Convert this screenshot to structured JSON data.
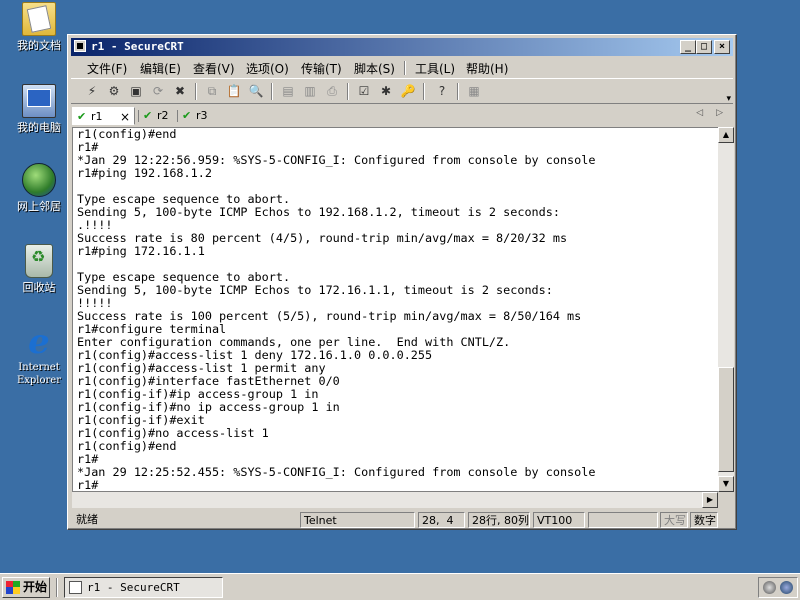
{
  "desktop": {
    "icons": [
      {
        "label": "我的文档",
        "icon": "my-documents-icon"
      },
      {
        "label": "我的电脑",
        "icon": "my-computer-icon"
      },
      {
        "label": "网上邻居",
        "icon": "network-places-icon"
      },
      {
        "label": "回收站",
        "icon": "recycle-bin-icon"
      },
      {
        "label": "Internet\nExplorer",
        "icon": "internet-explorer-icon"
      }
    ]
  },
  "window": {
    "title": "r1 - SecureCRT",
    "buttons": {
      "minimize": "_",
      "maximize": "□",
      "close": "×"
    }
  },
  "menu": [
    "文件(F)",
    "编辑(E)",
    "查看(V)",
    "选项(O)",
    "传输(T)",
    "脚本(S)",
    "工具(L)",
    "帮助(H)"
  ],
  "tabs": [
    {
      "label": "r1",
      "active": true,
      "close": "×"
    },
    {
      "label": "r2",
      "active": false
    },
    {
      "label": "r3",
      "active": false
    }
  ],
  "terminal": {
    "lines": [
      "r1(config)#end",
      "r1#",
      "*Jan 29 12:22:56.959: %SYS-5-CONFIG_I: Configured from console by console",
      "r1#ping 192.168.1.2",
      "",
      "Type escape sequence to abort.",
      "Sending 5, 100-byte ICMP Echos to 192.168.1.2, timeout is 2 seconds:",
      ".!!!!",
      "Success rate is 80 percent (4/5), round-trip min/avg/max = 8/20/32 ms",
      "r1#ping 172.16.1.1",
      "",
      "Type escape sequence to abort.",
      "Sending 5, 100-byte ICMP Echos to 172.16.1.1, timeout is 2 seconds:",
      "!!!!!",
      "Success rate is 100 percent (5/5), round-trip min/avg/max = 8/50/164 ms",
      "r1#configure terminal",
      "Enter configuration commands, one per line.  End with CNTL/Z.",
      "r1(config)#access-list 1 deny 172.16.1.0 0.0.0.255",
      "r1(config)#access-list 1 permit any",
      "r1(config)#interface fastEthernet 0/0",
      "r1(config-if)#ip access-group 1 in",
      "r1(config-if)#no ip access-group 1 in",
      "r1(config-if)#exit",
      "r1(config)#no access-list 1",
      "r1(config)#end",
      "r1#",
      "*Jan 29 12:25:52.455: %SYS-5-CONFIG_I: Configured from console by console",
      "r1#"
    ]
  },
  "status": {
    "ready": "就绪",
    "protocol": "Telnet",
    "cursor": "28,  4",
    "size": "28行, 80列",
    "emulation": "VT100",
    "empty": "",
    "caps": "大写",
    "num": "数字"
  },
  "taskbar": {
    "start": "开始",
    "task": "r1 - SecureCRT"
  }
}
